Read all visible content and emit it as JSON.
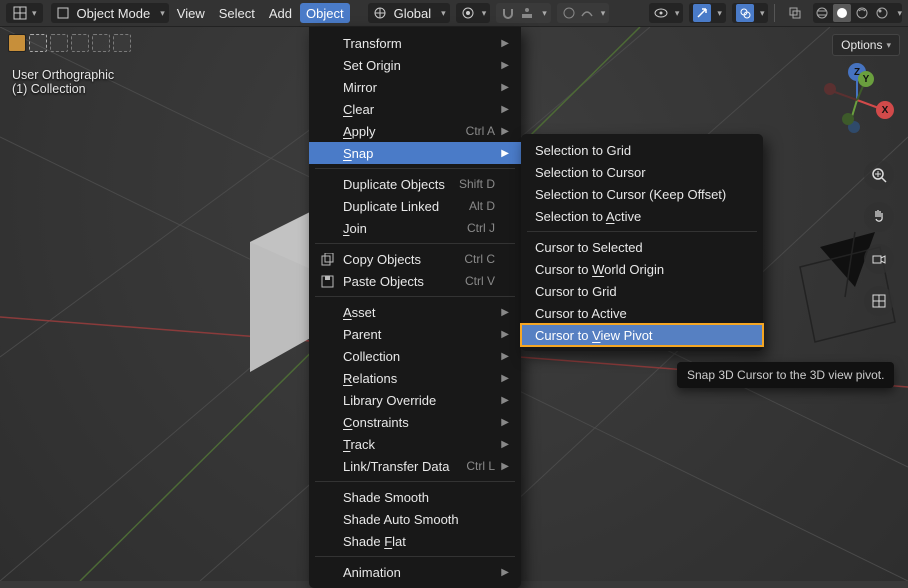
{
  "header": {
    "mode_label": "Object Mode",
    "menus": [
      "View",
      "Select",
      "Add",
      "Object"
    ],
    "orientation_label": "Global"
  },
  "viewport": {
    "projection": "User Orthographic",
    "collection": "(1) Collection",
    "options_label": "Options"
  },
  "tooltip": "Snap 3D Cursor to the 3D view pivot.",
  "gizmo_axes": {
    "x": "X",
    "y": "Y",
    "z": "Z"
  },
  "object_menu": [
    {
      "t": "item",
      "label": "Transform",
      "arrow": true
    },
    {
      "t": "item",
      "label": "Set Origin",
      "arrow": true
    },
    {
      "t": "item",
      "label": "Mirror",
      "arrow": true
    },
    {
      "t": "item",
      "label": "Clear",
      "arrow": true,
      "mn": "C"
    },
    {
      "t": "item",
      "label": "Apply",
      "arrow": true,
      "short": "Ctrl A",
      "mn": "A"
    },
    {
      "t": "item",
      "label": "Snap",
      "arrow": true,
      "highlight": true,
      "mn": "S"
    },
    {
      "t": "sep"
    },
    {
      "t": "item",
      "label": "Duplicate Objects",
      "short": "Shift D"
    },
    {
      "t": "item",
      "label": "Duplicate Linked",
      "short": "Alt D"
    },
    {
      "t": "item",
      "label": "Join",
      "short": "Ctrl J",
      "mn": "J"
    },
    {
      "t": "sep"
    },
    {
      "t": "item",
      "label": "Copy Objects",
      "short": "Ctrl C",
      "icon": "copy"
    },
    {
      "t": "item",
      "label": "Paste Objects",
      "short": "Ctrl V",
      "icon": "paste"
    },
    {
      "t": "sep"
    },
    {
      "t": "item",
      "label": "Asset",
      "arrow": true,
      "mn": "A"
    },
    {
      "t": "item",
      "label": "Parent",
      "arrow": true
    },
    {
      "t": "item",
      "label": "Collection",
      "arrow": true
    },
    {
      "t": "item",
      "label": "Relations",
      "arrow": true,
      "mn": "R"
    },
    {
      "t": "item",
      "label": "Library Override",
      "arrow": true
    },
    {
      "t": "item",
      "label": "Constraints",
      "arrow": true,
      "mn": "C"
    },
    {
      "t": "item",
      "label": "Track",
      "arrow": true,
      "mn": "T"
    },
    {
      "t": "item",
      "label": "Link/Transfer Data",
      "arrow": true,
      "short": "Ctrl L"
    },
    {
      "t": "sep"
    },
    {
      "t": "item",
      "label": "Shade Smooth"
    },
    {
      "t": "item",
      "label": "Shade Auto Smooth"
    },
    {
      "t": "item",
      "label": "Shade Flat",
      "mn": "F"
    },
    {
      "t": "sep"
    },
    {
      "t": "item",
      "label": "Animation",
      "arrow": true
    }
  ],
  "snap_submenu": [
    {
      "t": "item",
      "label": "Selection to Grid"
    },
    {
      "t": "item",
      "label": "Selection to Cursor"
    },
    {
      "t": "item",
      "label": "Selection to Cursor (Keep Offset)"
    },
    {
      "t": "item",
      "label": "Selection to Active",
      "mn": "A"
    },
    {
      "t": "sep"
    },
    {
      "t": "item",
      "label": "Cursor to Selected"
    },
    {
      "t": "item",
      "label": "Cursor to World Origin",
      "mn": "W"
    },
    {
      "t": "item",
      "label": "Cursor to Grid"
    },
    {
      "t": "item",
      "label": "Cursor to Active"
    },
    {
      "t": "item",
      "label": "Cursor to View Pivot",
      "mn": "V",
      "hover": true
    }
  ]
}
